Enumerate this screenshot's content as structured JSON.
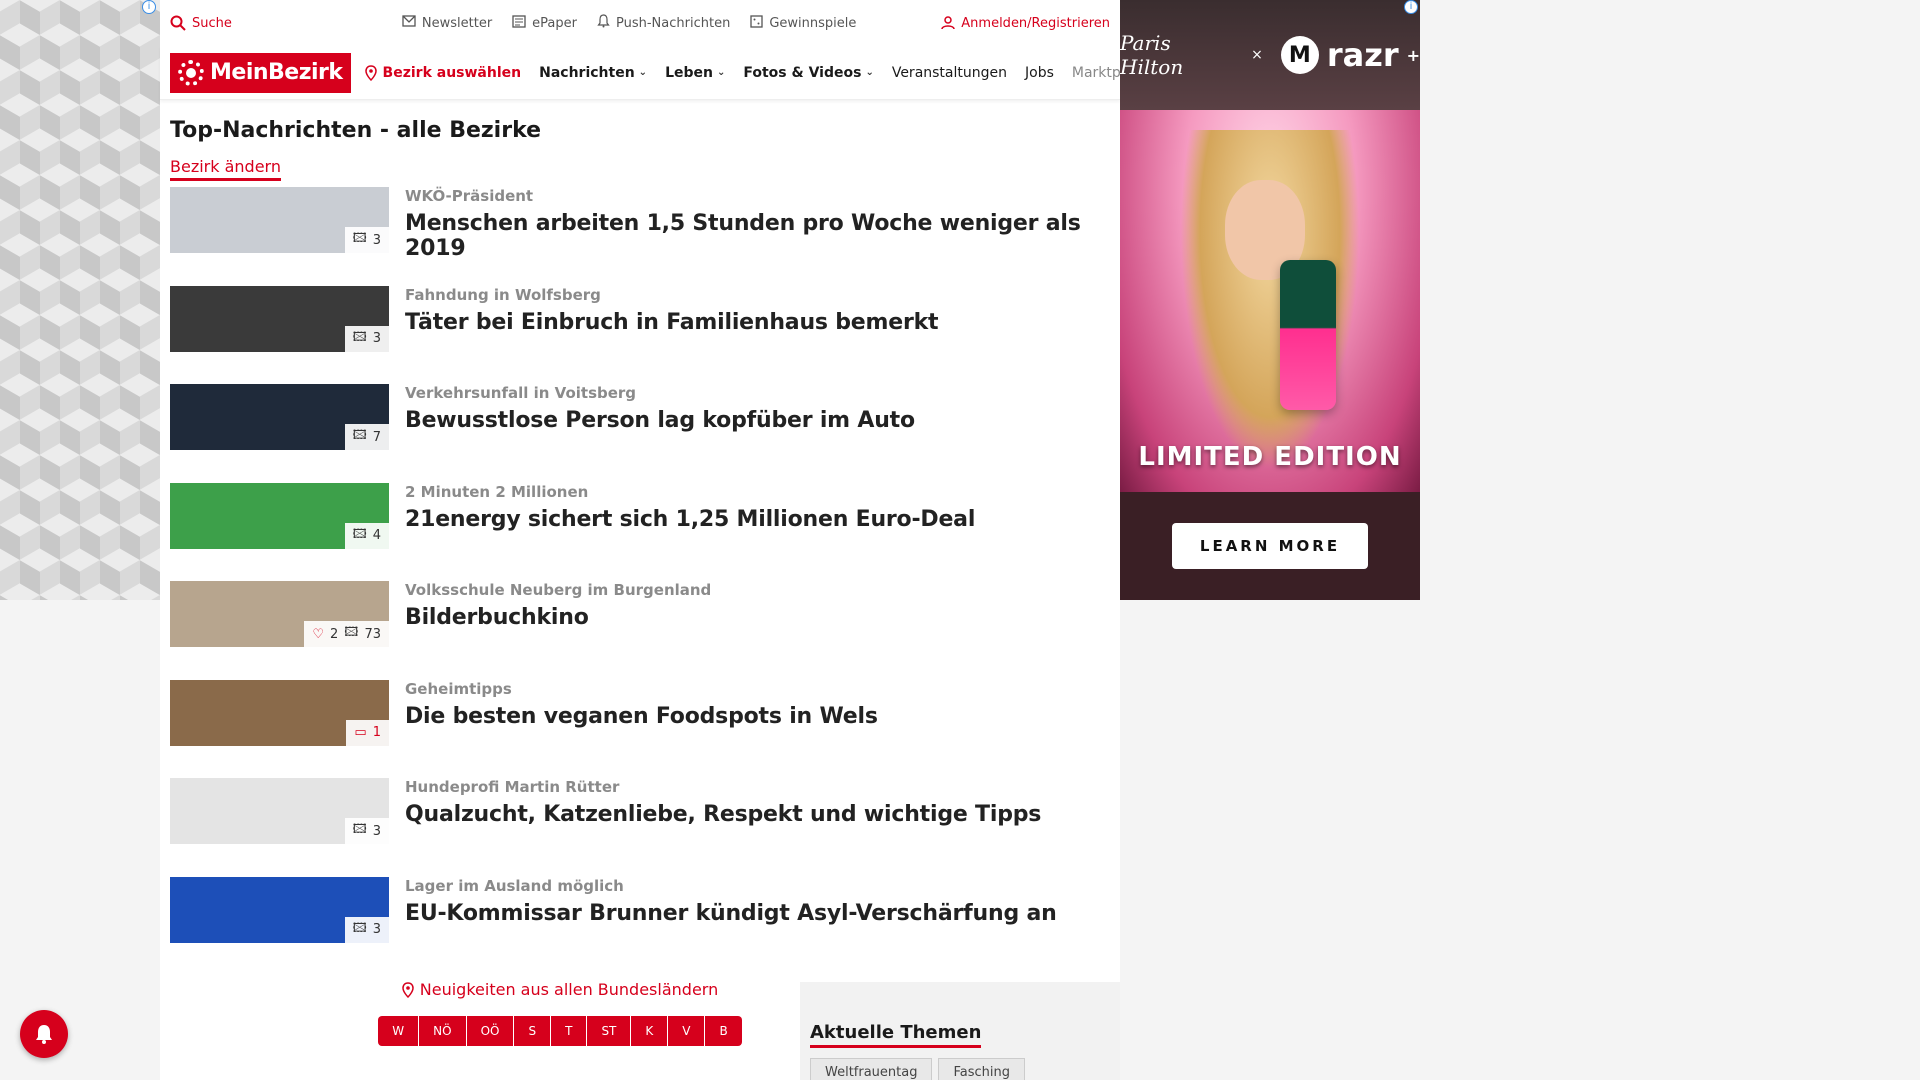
{
  "topbar": {
    "search_label": "Suche",
    "links": [
      {
        "icon": "mail-icon",
        "label": "Newsletter"
      },
      {
        "icon": "newspaper-icon",
        "label": "ePaper"
      },
      {
        "icon": "bell-icon",
        "label": "Push-Nachrichten"
      },
      {
        "icon": "gift-icon",
        "label": "Gewinnspiele"
      }
    ],
    "login_label": "Anmelden/Registrieren"
  },
  "nav": {
    "logo_text": "MeinBezirk",
    "district_label": "Bezirk auswählen",
    "items": [
      {
        "label": "Nachrichten",
        "dropdown": true
      },
      {
        "label": "Leben",
        "dropdown": true
      },
      {
        "label": "Fotos & Videos",
        "dropdown": true
      },
      {
        "label": "Veranstaltungen",
        "dropdown": false
      },
      {
        "label": "Jobs",
        "dropdown": false
      },
      {
        "label": "Marktplatz",
        "dropdown": false
      }
    ]
  },
  "main": {
    "title": "Top-Nachrichten - alle Bezirke",
    "change_district": "Bezirk ändern",
    "articles": [
      {
        "kicker": "WKÖ-Präsident",
        "headline": "Menschen arbeiten 1,5 Stunden pro Woche weniger als 2019",
        "images": "3",
        "likes": "",
        "comments": "",
        "thumb_color": "#c9cdd3"
      },
      {
        "kicker": "Fahndung in Wolfsberg",
        "headline": "Täter bei Einbruch in Familienhaus bemerkt",
        "images": "3",
        "likes": "",
        "comments": "",
        "thumb_color": "#3a3a3a"
      },
      {
        "kicker": "Verkehrsunfall in Voitsberg",
        "headline": "Bewusstlose Person lag kopfüber im Auto",
        "images": "7",
        "likes": "",
        "comments": "",
        "thumb_color": "#1f2a3a"
      },
      {
        "kicker": "2 Minuten 2 Millionen",
        "headline": "21energy sichert sich 1,25 Millionen Euro-Deal",
        "images": "4",
        "likes": "",
        "comments": "",
        "thumb_color": "#3da04a"
      },
      {
        "kicker": "Volksschule Neuberg im Burgenland",
        "headline": "Bilderbuchkino",
        "images": "73",
        "likes": "2",
        "comments": "",
        "thumb_color": "#b7a58e"
      },
      {
        "kicker": "Geheimtipps",
        "headline": "Die besten veganen Foodspots in Wels",
        "images": "",
        "likes": "",
        "comments": "1",
        "thumb_color": "#8a6a4a"
      },
      {
        "kicker": "Hundeprofi Martin Rütter",
        "headline": "Qualzucht, Katzenliebe, Respekt und wichtige Tipps",
        "images": "3",
        "likes": "",
        "comments": "",
        "thumb_color": "#e4e4e4"
      },
      {
        "kicker": "Lager im Ausland möglich",
        "headline": "EU-Kommissar Brunner kündigt Asyl-Verschärfung an",
        "images": "3",
        "likes": "",
        "comments": "",
        "thumb_color": "#1d4fb8"
      }
    ]
  },
  "bundeslaender": {
    "title": "Neuigkeiten aus allen Bundesländern",
    "states": [
      "W",
      "NÖ",
      "OÖ",
      "S",
      "T",
      "ST",
      "K",
      "V",
      "B"
    ]
  },
  "themen": {
    "title": "Aktuelle Themen",
    "chips": [
      "Weltfrauentag",
      "Fasching"
    ]
  },
  "ad": {
    "signature": "Paris Hilton",
    "x": "×",
    "brand": "razr",
    "brand_sup": "+",
    "tagline": "LIMITED EDITION",
    "cta": "LEARN MORE"
  }
}
